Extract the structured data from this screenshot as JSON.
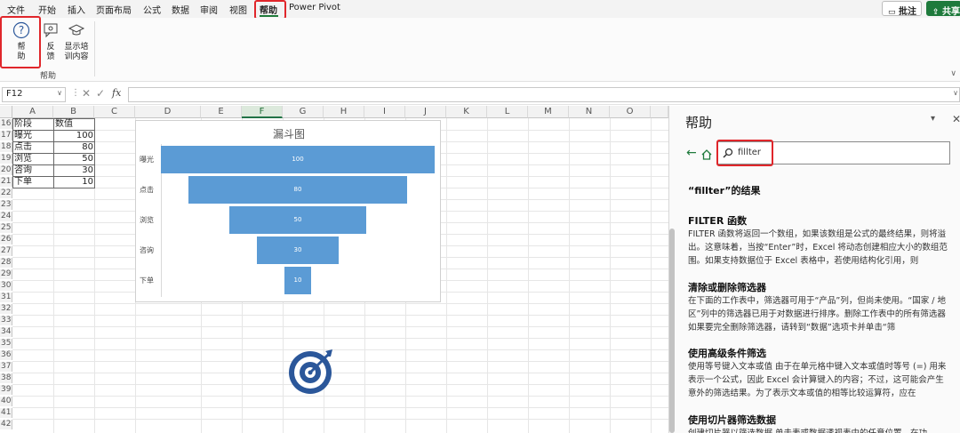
{
  "menu": {
    "items": [
      "文件",
      "开始",
      "插入",
      "页面布局",
      "公式",
      "数据",
      "审阅",
      "视图",
      "帮助",
      "Power Pivot"
    ],
    "active": "帮助",
    "comment_label": "批注",
    "share_label": "共享"
  },
  "ribbon": {
    "help_label": "帮\n助",
    "feedback_label": "反\n馈",
    "training_label": "显示培\n训内容",
    "group_label": "帮助"
  },
  "formula_bar": {
    "name_box": "F12",
    "fx": "fx",
    "value": ""
  },
  "grid": {
    "columns": [
      "A",
      "B",
      "C",
      "D",
      "E",
      "F",
      "G",
      "H",
      "I",
      "J",
      "K",
      "L",
      "M",
      "N",
      "O"
    ],
    "selected_column": "F",
    "rows": [
      "16",
      "17",
      "18",
      "19",
      "20",
      "21",
      "22",
      "23",
      "24",
      "25",
      "26",
      "27",
      "28",
      "29",
      "30",
      "31",
      "32",
      "33",
      "34",
      "35",
      "36",
      "37",
      "38",
      "39",
      "40",
      "41",
      "42"
    ],
    "table": {
      "headers": [
        "阶段",
        "数值"
      ],
      "rows": [
        [
          "曝光",
          "100"
        ],
        [
          "点击",
          "80"
        ],
        [
          "浏览",
          "50"
        ],
        [
          "咨询",
          "30"
        ],
        [
          "下单",
          "10"
        ]
      ]
    }
  },
  "chart_data": {
    "type": "bar",
    "title": "漏斗图",
    "categories": [
      "曝光",
      "点击",
      "浏览",
      "咨询",
      "下单"
    ],
    "values": [
      100,
      80,
      50,
      30,
      10
    ],
    "xlim": [
      0,
      100
    ],
    "data_labels": true,
    "color": "#5b9bd5"
  },
  "help_pane": {
    "title": "帮助",
    "search_value": "fillter",
    "results_heading": "“fillter”的结果",
    "results": [
      {
        "title": "FILTER 函数",
        "body": "FILTER 函数将返回一个数组，如果该数组是公式的最终结果，则将溢出。这意味着，当按“Enter”时，Excel 将动态创建相应大小的数组范围。如果支持数据位于 Excel 表格中，若使用结构化引用，则"
      },
      {
        "title": "清除或删除筛选器",
        "body": "在下面的工作表中，筛选器可用于“产品”列，但尚未使用。“国家 / 地区”列中的筛选器已用于对数据进行排序。删除工作表中的所有筛选器 如果要完全删除筛选器，请转到“数据”选项卡并单击“筛"
      },
      {
        "title": "使用高级条件筛选",
        "body": "使用等号键入文本或值 由于在单元格中键入文本或值时等号 (=) 用来表示一个公式，因此 Excel 会计算键入的内容；不过，这可能会产生意外的筛选结果。为了表示文本或值的相等比较运算符，应在"
      },
      {
        "title": "使用切片器筛选数据",
        "body": "创建切片器以筛选数据 单击表或数据透视表中的任意位置。在功"
      }
    ]
  },
  "colors": {
    "accent_green": "#217346",
    "highlight_red": "#e0262b",
    "bar_blue": "#5b9bd5",
    "target_icon": "#2b579a"
  }
}
